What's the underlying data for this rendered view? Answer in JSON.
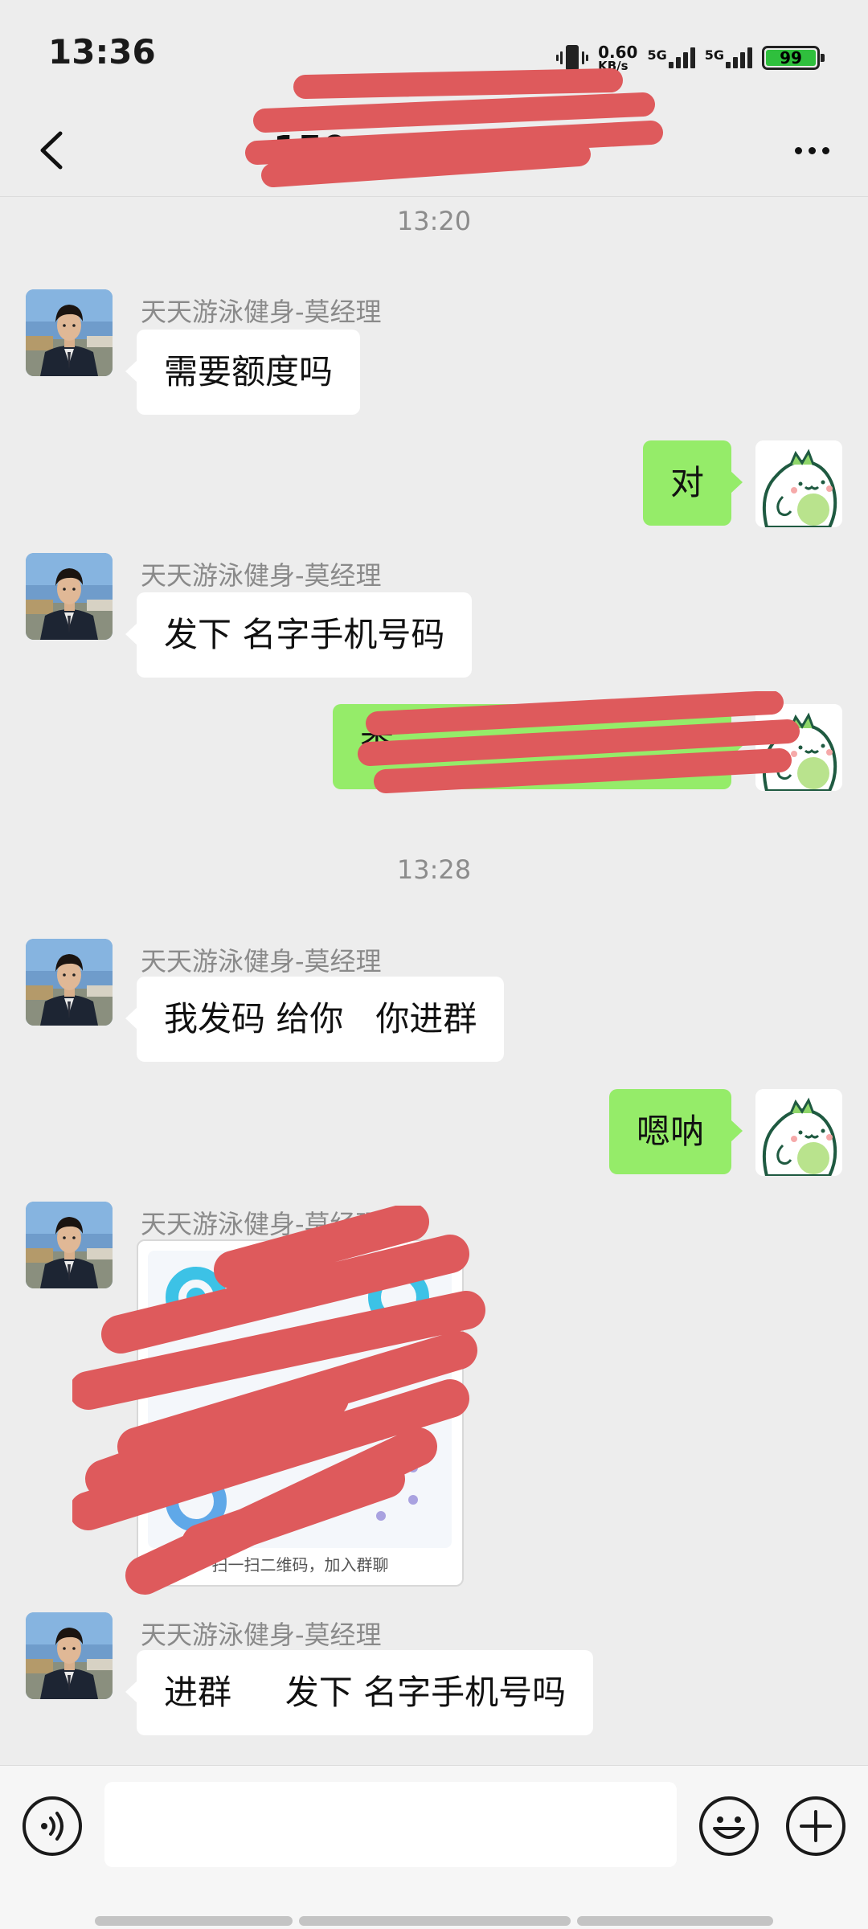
{
  "status_bar": {
    "time": "13:36",
    "net_speed_value": "0.60",
    "net_speed_unit": "KB/s",
    "sim1_type": "5G",
    "sim2_type": "5G",
    "battery": "99"
  },
  "header": {
    "title": "150",
    "back_icon": "chevron-left-icon",
    "more_icon": "more-dots-icon"
  },
  "messages": {
    "t1": "13:20",
    "m1": {
      "sender": "天天游泳健身-莫经理",
      "text": "需要额度吗"
    },
    "m2": {
      "text": "对"
    },
    "m3": {
      "sender": "天天游泳健身-莫经理",
      "text": "发下 名字手机号码"
    },
    "m4": {
      "text": "李"
    },
    "t2": "13:28",
    "m5": {
      "sender": "天天游泳健身-莫经理",
      "text": "我发码 给你   你进群"
    },
    "m6": {
      "text": "嗯呐"
    },
    "m7": {
      "sender": "天天游泳健身-莫经理",
      "qr_caption": "扫一扫二维码，加入群聊"
    },
    "m8": {
      "sender": "天天游泳健身-莫经理",
      "text": "进群     发下 名字手机号吗"
    }
  },
  "input_bar": {
    "voice_icon": "voice-icon",
    "emoji_icon": "emoji-icon",
    "plus_icon": "plus-icon",
    "text_value": ""
  },
  "colors": {
    "background": "#ededed",
    "sent_bubble": "#95ec69",
    "received_bubble": "#ffffff",
    "redaction": "#de5a5c"
  }
}
